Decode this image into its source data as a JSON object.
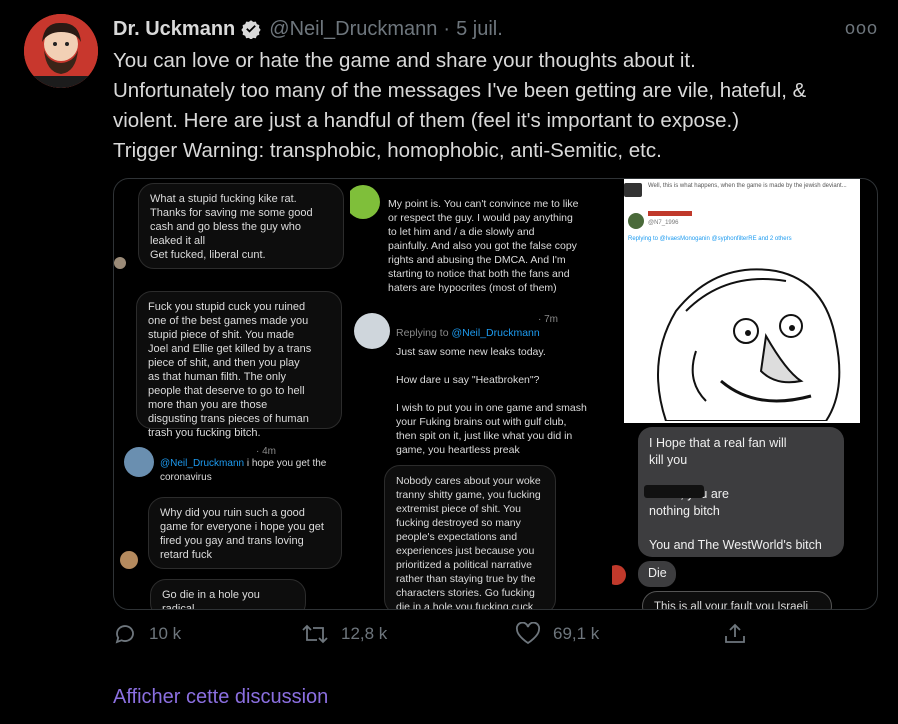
{
  "author": {
    "name": "Dr. Uckmann",
    "handle": "@Neil_Druckmann",
    "separator": "·",
    "date": "5 juil.",
    "more_label": "ooo"
  },
  "tweet": {
    "text": "You can love or hate the game and share your thoughts about it.\nUnfortunately too many of the messages I've been getting are vile, hateful, &\nviolent. Here are just a handful of them (feel it's important to expose.)\nTrigger Warning: transphobic, homophobic, anti-Semitic, etc."
  },
  "media": {
    "panel1": {
      "msg1": "What a stupid fucking kike rat.\nThanks for saving me some good\ncash and go bless the guy who\nleaked it all\nGet fucked, liberal cunt.",
      "msg2": "Fuck you stupid cuck you ruined\none of the best games made you\nstupid piece of shit. You made\nJoel and Ellie get killed by a trans\npiece of shit, and then you play\nas that human filth. The only\npeople that deserve to go to hell\nmore than you are those\ndisgusting trans pieces of human\ntrash you fucking bitch.",
      "time": "· 4m",
      "reply_handle": "@Neil_Druckmann",
      "reply_text": " i hope you get the\ncoronavirus",
      "msg3": "Why did you ruin such a good\ngame for everyone i hope you get\nfired you gay and trans loving\nretard fuck",
      "msg4": "Go die in a hole you radical\nfeminist"
    },
    "panel2": {
      "msg1": "My point is. You can't convince me to like\nor respect the guy. I would pay anything\nto let him and /     a die slowly and\npainfully. And also you got the false copy\nrights and abusing the DMCA. And I'm\nstarting to notice that both the fans and\nhaters are hypocrites (most of them)",
      "time": "· 7m",
      "replying_to": "Replying to ",
      "reply_handle": "@Neil_Druckmann",
      "reply_text": "Just saw some new leaks today.\n\nHow dare u say \"Heatbroken\"?\n\nI wish to put you in one game and smash\nyour Fuking brains out with gulf club,\nthen spit on it, just like what you did in\ngame, you heartless preak",
      "msg2": "Nobody cares about your woke\ntranny shitty game, you fucking\nextremist piece of shit. You\nfucking destroyed so many\npeople's expectations and\nexperiences just because you\nprioritized a political narrative\nrather than staying true by the\ncharacters stories. Go fucking\ndie in a hole you fucking cuck"
    },
    "panel3": {
      "tweet_snippet": "Well, this is what happens, when the game is made by the jewish deviant...",
      "user_handle": "@N7_1996",
      "replying": "Replying to @IvaesMonoganin @syphonfilterRE and 2 others",
      "msg1": "I Hope that a real fan will\nkill you\n\n                IS all , you are\nnothing bitch\n\nYou and The WestWorld's bitch",
      "msg2": "Die",
      "msg3": "This is all your fault you Israeli"
    }
  },
  "actions": {
    "reply_count": "10 k",
    "retweet_count": "12,8 k",
    "like_count": "69,1 k"
  },
  "thread_link": "Afficher cette discussion",
  "colors": {
    "background": "#000000",
    "text": "#d9d9d9",
    "muted": "#6e767d",
    "link": "#1d9bf0",
    "thread_link": "#8b6fe0"
  }
}
